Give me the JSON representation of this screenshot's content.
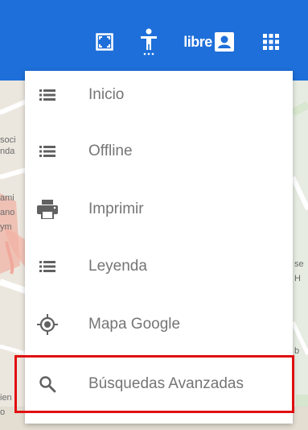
{
  "header": {
    "libre_label": "libre",
    "icons": [
      "fullscreen-icon",
      "accessibility-icon",
      "user-icon",
      "apps-grid-icon"
    ],
    "background": "#1e6fd9"
  },
  "map_labels": [
    "soci",
    "nda",
    "ami",
    "ano",
    "ym",
    "se",
    "H",
    "b",
    "ien",
    "o"
  ],
  "menu": {
    "items": [
      {
        "label": "Inicio",
        "icon": "list-icon"
      },
      {
        "label": "Offline",
        "icon": "list-icon"
      },
      {
        "label": "Imprimir",
        "icon": "printer-icon"
      },
      {
        "label": "Leyenda",
        "icon": "list-icon"
      },
      {
        "label": "Mapa Google",
        "icon": "location-target-icon"
      },
      {
        "label": "Búsquedas Avanzadas",
        "icon": "search-icon"
      }
    ],
    "highlight_color": "#e01010"
  }
}
